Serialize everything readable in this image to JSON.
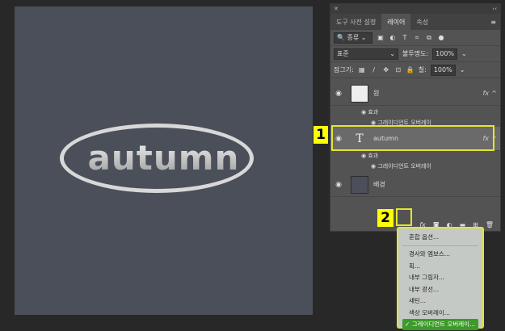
{
  "canvas": {
    "text": "autumn",
    "background": "#4a4f59"
  },
  "panel": {
    "tabs": [
      {
        "label": "도구 사전 설정"
      },
      {
        "label": "레이어"
      },
      {
        "label": "속성"
      }
    ],
    "filter": {
      "label": "종류"
    },
    "blend_mode": "표준",
    "opacity_label": "불투명도:",
    "opacity": "100%",
    "lock_label": "잠그기:",
    "fill_label": "칠:",
    "fill": "100%",
    "layers": [
      {
        "name": "원",
        "effects_label": "효과",
        "effect": "그레이디언트 오버레이"
      },
      {
        "name": "autumn",
        "effects_label": "효과",
        "effect": "그레이디언트 오버레이"
      },
      {
        "name": "배경"
      }
    ],
    "fx_label": "fx"
  },
  "callouts": [
    "1",
    "2"
  ],
  "menu": {
    "items": [
      "혼합 옵션...",
      "경사와 엠보스...",
      "획...",
      "내부 그림자...",
      "내부 광선...",
      "새틴...",
      "색상 오버레이...",
      "그레이디언트 오버레이..."
    ],
    "selected_check": "✓"
  },
  "colors": {
    "highlight": "#ffff00",
    "selected": "#3c9a2a"
  }
}
